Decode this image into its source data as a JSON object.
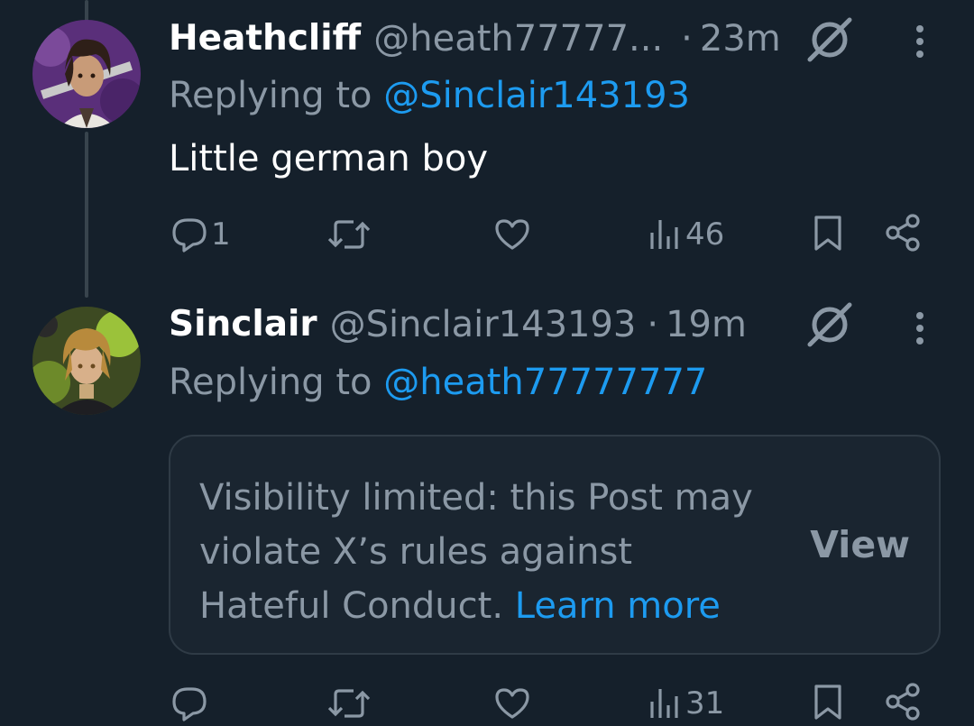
{
  "tweets": [
    {
      "display_name": "Heathcliff",
      "handle": "@heath77777...",
      "separator": "·",
      "time": "23m",
      "replying_prefix": "Replying to ",
      "replying_to": "@Sinclair143193",
      "text": "Little german boy",
      "actions": {
        "reply_count": "1",
        "repost_count": "",
        "like_count": "",
        "views_count": "46"
      }
    },
    {
      "display_name": "Sinclair",
      "handle": "@Sinclair143193",
      "separator": "·",
      "time": "19m",
      "replying_prefix": "Replying to ",
      "replying_to": "@heath77777777",
      "notice": {
        "text": "Visibility limited: this Post may violate X’s rules against Hateful Conduct.",
        "link": "Learn more",
        "button": "View"
      },
      "actions": {
        "reply_count": "",
        "repost_count": "",
        "like_count": "",
        "views_count": "31"
      }
    }
  ],
  "colors": {
    "background": "#15202b",
    "text_primary": "#ffffff",
    "text_secondary": "#8b98a5",
    "accent": "#1d9bf0",
    "border": "#2f3b46"
  },
  "icons": [
    "grok-icon",
    "more-options-icon",
    "reply-icon",
    "repost-icon",
    "like-icon",
    "views-icon",
    "bookmark-icon",
    "share-icon"
  ]
}
